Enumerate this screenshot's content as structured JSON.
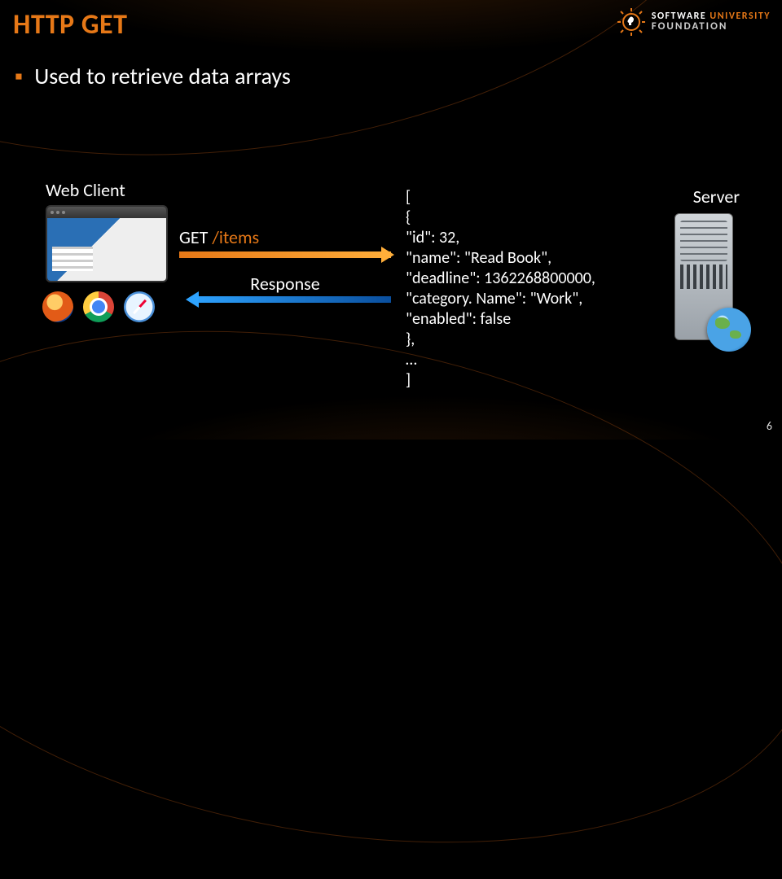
{
  "title": "HTTP GET",
  "subtitle": "Used to retrieve data arrays",
  "logo": {
    "line1a": "SOFTWARE",
    "line1b": "UNIVERSITY",
    "line2": "FOUNDATION"
  },
  "webclient_label": "Web Client",
  "server_label": "Server",
  "request": {
    "method": "GET",
    "path": "/items"
  },
  "response_label": "Response",
  "json_payload": "[\n{\n\"id\": 32,\n\"name\": \"Read Book\",\n\"deadline\": 1362268800000,\n\"category. Name\": \"Work\",\n\"enabled\": false\n},\n…\n]",
  "page_number": "6",
  "icons": {
    "logo": "lightbulb-gear-icon",
    "browsers": [
      "firefox-icon",
      "chrome-icon",
      "safari-icon"
    ],
    "server": "server-tower-icon",
    "globe": "globe-icon"
  }
}
